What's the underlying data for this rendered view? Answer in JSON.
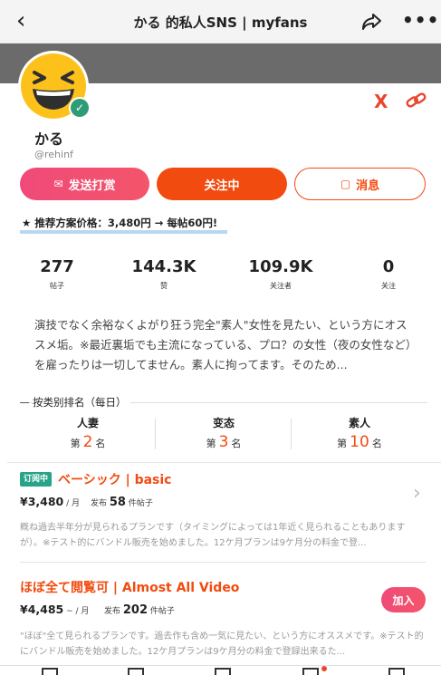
{
  "header": {
    "title": "かる 的私人SNS | myfans",
    "back_icon": "chevron-left-icon",
    "share_icon": "share-icon",
    "more_icon": "more-icon",
    "more_glyph": "•••"
  },
  "profile": {
    "name": "かる",
    "handle": "@rehinf",
    "avatar_icon": "laughing-emoji-icon",
    "verified_icon": "check-badge-icon",
    "verified_glyph": "✓",
    "x_glyph": "X"
  },
  "actions": {
    "gift_label": "发送打赏",
    "follow_label": "关注中",
    "message_label": "消息"
  },
  "promo": {
    "star": "★",
    "text": "推荐方案价格：3,480円 → 每帖60円!"
  },
  "stats": [
    {
      "num": "277",
      "label": "帖子"
    },
    {
      "num": "144.3K",
      "label": "赞"
    },
    {
      "num": "109.9K",
      "label": "关注者"
    },
    {
      "num": "0",
      "label": "关注"
    }
  ],
  "bio": "演技でなく余裕なくよがり狂う完全\"素人\"女性を見たい、という方にオススメ垢。※最近裏垢でも主流になっている、プロ？の女性（夜の女性など）を雇ったりは一切してません。素人に拘ってます。そのため...",
  "ranking": {
    "title": "按类别排名（每日）",
    "items": [
      {
        "name": "人妻",
        "pre": "第",
        "rank": "2",
        "post": "名"
      },
      {
        "name": "变态",
        "pre": "第",
        "rank": "3",
        "post": "名"
      },
      {
        "name": "素人",
        "pre": "第",
        "rank": "10",
        "post": "名"
      }
    ]
  },
  "plans": [
    {
      "tag": "订阅中",
      "title": "ベーシック | basic",
      "price": "¥3,480",
      "unit": " / 月",
      "count_pre": "发布",
      "count": "58",
      "count_post": "件帖子",
      "desc": "概ね過去半年分が見られるプランです（タイミングによっては1年近く見られることもありますが）。※テスト的にバンドル販売を始めました。12ケ月プランは9ケ月分の料金で登..."
    },
    {
      "title": "ほぼ全て閲覧可 | Almost All Video",
      "price": "¥4,485",
      "unit": " ~ / 月",
      "count_pre": "发布",
      "count": "202",
      "count_post": "件帖子",
      "join_label": "加入",
      "desc": "\"ほぼ\"全て見られるプランです。過去作も含め一気に見たい、という方にオススメです。※テスト的にバンドル販売を始めました。12ケ月プランは9ケ月分の料金で登録出来るた..."
    }
  ],
  "colors": {
    "accent": "#f24b0f",
    "pink": "#f04a7a",
    "subscribed": "#27a38a",
    "cover": "#6b6b6b"
  }
}
